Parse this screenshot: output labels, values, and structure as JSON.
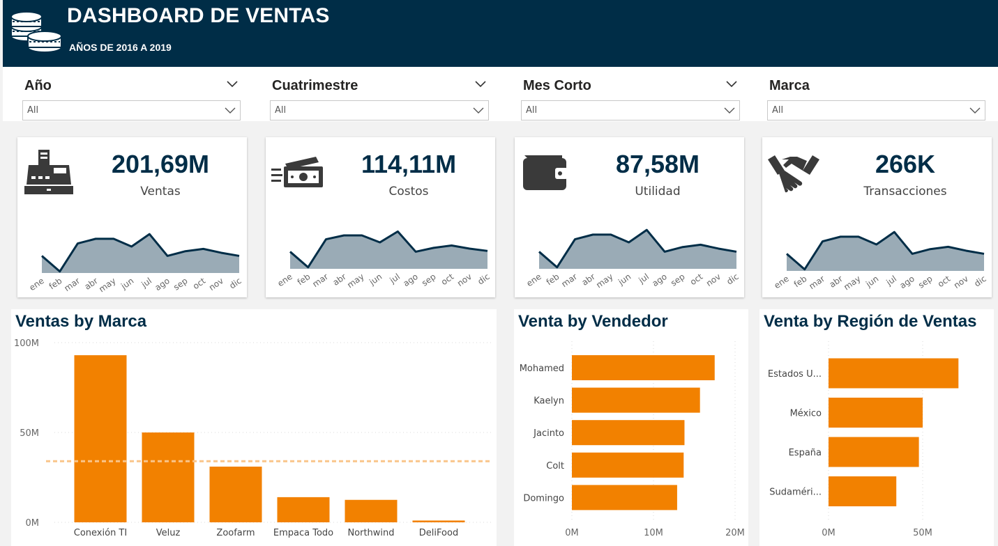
{
  "header": {
    "title": "DASHBOARD DE VENTAS",
    "subtitle": "AÑOS DE 2016 A 2019",
    "icon": "coins-icon",
    "bg_color": "#002d47"
  },
  "slicers": [
    {
      "title": "Año",
      "value": "All"
    },
    {
      "title": "Cuatrimestre",
      "value": "All"
    },
    {
      "title": "Mes Corto",
      "value": "All"
    },
    {
      "title": "Marca",
      "value": "All"
    }
  ],
  "kpis": [
    {
      "value": "201,69M",
      "label": "Ventas",
      "icon": "cash-register-icon"
    },
    {
      "value": "114,11M",
      "label": "Costos",
      "icon": "money-bill-icon"
    },
    {
      "value": "87,58M",
      "label": "Utilidad",
      "icon": "wallet-icon"
    },
    {
      "value": "266K",
      "label": "Transacciones",
      "icon": "handshake-icon"
    }
  ],
  "colors": {
    "navy": "#002d47",
    "orange": "#f28100",
    "average_line": "#f9c58a",
    "spark_fill": "#9aabb6"
  },
  "chart_data": [
    {
      "type": "area",
      "name_hint": "Ventas sparkline",
      "categories": [
        "ene",
        "feb",
        "mar",
        "abr",
        "may",
        "jun",
        "jul",
        "ago",
        "sep",
        "oct",
        "nov",
        "dic"
      ],
      "values": [
        11,
        1,
        19,
        22,
        22,
        17,
        25,
        11,
        14,
        15.5,
        13,
        11
      ],
      "ylim": [
        0,
        30
      ]
    },
    {
      "type": "area",
      "name_hint": "Costos sparkline",
      "categories": [
        "ene",
        "feb",
        "mar",
        "abr",
        "may",
        "jun",
        "jul",
        "ago",
        "sep",
        "oct",
        "nov",
        "dic"
      ],
      "values": [
        11,
        1,
        19,
        21.5,
        21.5,
        17,
        24,
        11,
        13.5,
        15,
        13,
        11.5
      ],
      "ylim": [
        0,
        30
      ]
    },
    {
      "type": "area",
      "name_hint": "Utilidad sparkline",
      "categories": [
        "ene",
        "feb",
        "mar",
        "abr",
        "may",
        "jun",
        "jul",
        "ago",
        "sep",
        "oct",
        "nov",
        "dic"
      ],
      "values": [
        11,
        1,
        19,
        22,
        22,
        17,
        25,
        11,
        14,
        15.5,
        13,
        11
      ],
      "ylim": [
        0,
        30
      ]
    },
    {
      "type": "area",
      "name_hint": "Transacciones sparkline",
      "categories": [
        "ene",
        "feb",
        "mar",
        "abr",
        "may",
        "jun",
        "jul",
        "ago",
        "sep",
        "oct",
        "nov",
        "dic"
      ],
      "values": [
        11,
        1,
        19,
        22,
        22,
        17,
        25,
        11,
        14,
        15.5,
        13,
        11
      ],
      "ylim": [
        0,
        30
      ]
    },
    {
      "type": "bar",
      "title": "Ventas by Marca",
      "categories": [
        "Conexión TI",
        "Veluz",
        "Zoofarm",
        "Empaca Todo",
        "Northwind",
        "DeliFood"
      ],
      "values": [
        93,
        50,
        31,
        14,
        12.5,
        1
      ],
      "ylim": [
        0,
        100
      ],
      "yticks": [
        0,
        50,
        100
      ],
      "ytick_labels": [
        "0M",
        "50M",
        "100M"
      ],
      "average_line": 34,
      "grid": true
    },
    {
      "type": "bar",
      "orientation": "horizontal",
      "title": "Venta by Vendedor",
      "categories": [
        "Mohamed",
        "Kaelyn",
        "Jacinto",
        "Colt",
        "Domingo"
      ],
      "values": [
        17.5,
        15.7,
        13.8,
        13.7,
        12.9
      ],
      "xlim": [
        0,
        20
      ],
      "xticks": [
        0,
        10,
        20
      ],
      "xtick_labels": [
        "0M",
        "10M",
        "20M"
      ],
      "grid": true
    },
    {
      "type": "bar",
      "orientation": "horizontal",
      "title": "Venta by Región de Ventas",
      "categories": [
        "Estados U...",
        "México",
        "España",
        "Sudaméri..."
      ],
      "values": [
        69,
        50,
        48,
        36
      ],
      "xlim": [
        0,
        80
      ],
      "xticks": [
        0,
        50
      ],
      "xtick_labels": [
        "0M",
        "50M"
      ],
      "grid": true
    }
  ]
}
